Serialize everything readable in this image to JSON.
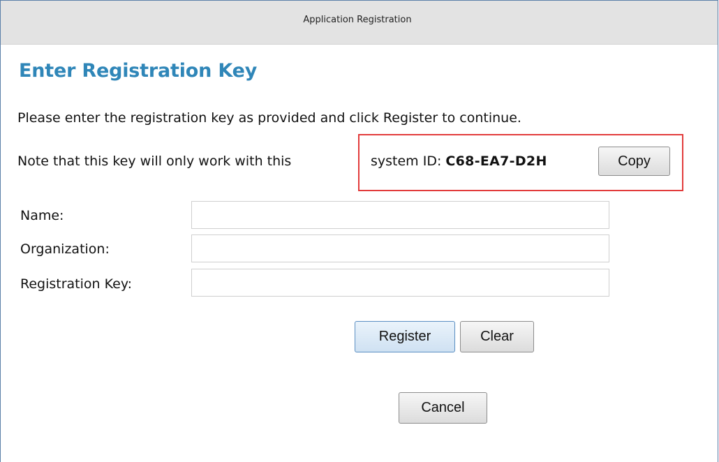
{
  "window": {
    "title": "Application Registration"
  },
  "page": {
    "heading": "Enter Registration Key",
    "instruction": "Please enter the registration key as provided and click Register to continue.",
    "note_prefix": "Note that this key will only work with this",
    "system_id_label": "system ID: ",
    "system_id_value": "C68-EA7-D2H",
    "copy_label": "Copy"
  },
  "form": {
    "fields": [
      {
        "label": "Name:",
        "value": "",
        "placeholder": ""
      },
      {
        "label": "Organization:",
        "value": "",
        "placeholder": ""
      },
      {
        "label": "Registration Key:",
        "value": "",
        "placeholder": ""
      }
    ],
    "register_label": "Register",
    "clear_label": "Clear",
    "cancel_label": "Cancel"
  },
  "colors": {
    "heading": "#2f86b8",
    "highlight_box": "#e23b3b",
    "titlebar": "#e3e3e3"
  }
}
